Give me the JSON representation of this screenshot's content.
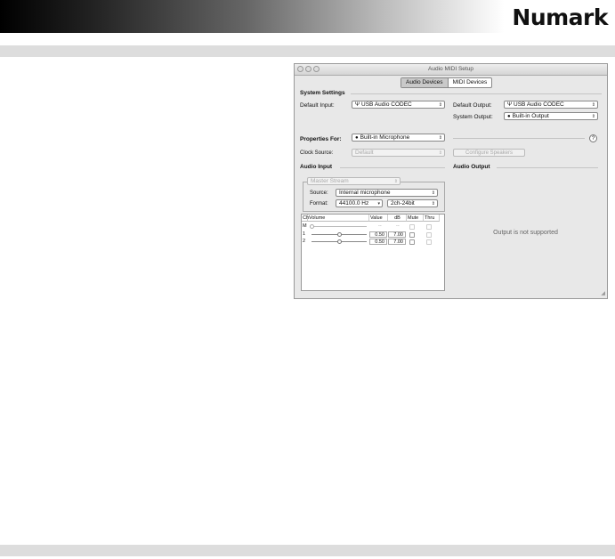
{
  "brand": {
    "logo": "Numark"
  },
  "window": {
    "title": "Audio MIDI Setup",
    "tabs": [
      {
        "label": "Audio Devices",
        "selected": true
      },
      {
        "label": "MIDI Devices",
        "selected": false
      }
    ],
    "system_settings": {
      "heading": "System Settings",
      "default_input_label": "Default Input:",
      "default_input_value": "USB Audio CODEC",
      "default_output_label": "Default Output:",
      "default_output_value": "USB Audio CODEC",
      "system_output_label": "System Output:",
      "system_output_value": "Built-in Output"
    },
    "properties": {
      "label": "Properties For:",
      "value": "Built-in Microphone",
      "help": "?",
      "clock_source_label": "Clock Source:",
      "clock_source_value": "Default",
      "configure_speakers": "Configure Speakers"
    },
    "audio_input": {
      "heading": "Audio Input",
      "stream": "Master Stream",
      "source_label": "Source:",
      "source_value": "Internal microphone",
      "format_label": "Format:",
      "format_rate": "44100.0 Hz",
      "format_bits": "2ch-24bit",
      "columns": [
        "Ch",
        "Volume",
        "Value",
        "dB",
        "Mute",
        "Thru"
      ],
      "rows": [
        {
          "ch": "M",
          "volume": 0.0,
          "value": "--",
          "db": "--"
        },
        {
          "ch": "1",
          "volume": 0.5,
          "value": "0.50",
          "db": "7.00"
        },
        {
          "ch": "2",
          "volume": 0.5,
          "value": "0.50",
          "db": "7.00"
        }
      ]
    },
    "audio_output": {
      "heading": "Audio Output",
      "message": "Output is not supported"
    }
  }
}
